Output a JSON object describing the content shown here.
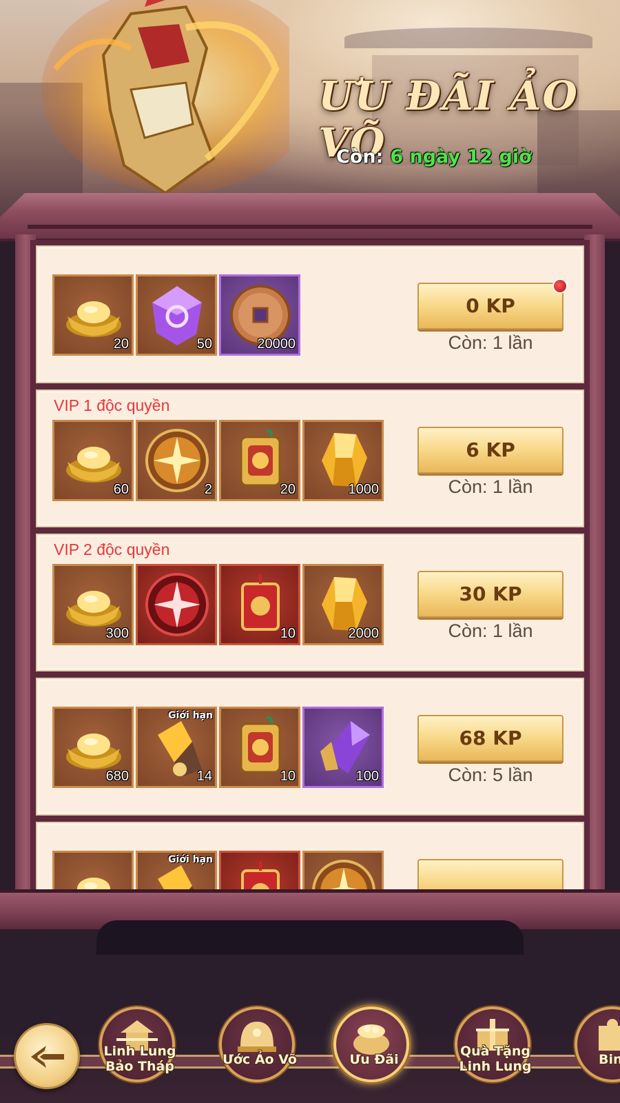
{
  "banner": {
    "title": "ƯU ĐÃI ẢO VÕ",
    "timer_label": "Còn:",
    "timer_value": "6 ngày 12 giờ"
  },
  "offers": [
    {
      "label": "",
      "items": [
        {
          "icon": "gold-ingot-icon",
          "qty": "20",
          "tag": ""
        },
        {
          "icon": "purple-crystal-icon",
          "qty": "50",
          "tag": ""
        },
        {
          "icon": "copper-coin-icon",
          "qty": "20000",
          "tag": ""
        }
      ],
      "price": "0 KP",
      "remaining": "Còn: 1 lần",
      "notification": true
    },
    {
      "label": "VIP 1 độc quyền",
      "items": [
        {
          "icon": "gold-ingot-icon",
          "qty": "60",
          "tag": ""
        },
        {
          "icon": "golden-star-orb-icon",
          "qty": "2",
          "tag": ""
        },
        {
          "icon": "dragon-token-icon",
          "qty": "20",
          "tag": ""
        },
        {
          "icon": "amber-gem-icon",
          "qty": "1000",
          "tag": ""
        }
      ],
      "price": "6 KP",
      "remaining": "Còn: 1 lần",
      "notification": false
    },
    {
      "label": "VIP 2 độc quyền",
      "items": [
        {
          "icon": "gold-ingot-icon",
          "qty": "300",
          "tag": ""
        },
        {
          "icon": "red-star-orb-icon",
          "qty": "",
          "tag": ""
        },
        {
          "icon": "red-talisman-icon",
          "qty": "10",
          "tag": ""
        },
        {
          "icon": "amber-gem-icon",
          "qty": "2000",
          "tag": ""
        }
      ],
      "price": "30 KP",
      "remaining": "Còn: 1 lần",
      "notification": false
    },
    {
      "label": "",
      "items": [
        {
          "icon": "gold-ingot-icon",
          "qty": "680",
          "tag": ""
        },
        {
          "icon": "golden-fragment-icon",
          "qty": "14",
          "tag": "Giới hạn"
        },
        {
          "icon": "dragon-token-icon",
          "qty": "10",
          "tag": ""
        },
        {
          "icon": "violet-shard-icon",
          "qty": "100",
          "tag": ""
        }
      ],
      "price": "68 KP",
      "remaining": "Còn: 5 lần",
      "notification": false
    },
    {
      "label": "",
      "items": [
        {
          "icon": "gold-ingot-icon",
          "qty": "",
          "tag": ""
        },
        {
          "icon": "golden-fragment-icon",
          "qty": "",
          "tag": "Giới hạn"
        },
        {
          "icon": "red-talisman-icon",
          "qty": "",
          "tag": ""
        },
        {
          "icon": "golden-star-orb-icon",
          "qty": "",
          "tag": ""
        }
      ],
      "price": "",
      "remaining": "",
      "notification": false
    }
  ],
  "nav": {
    "back_icon": "back-arrow-icon",
    "items": [
      {
        "label": "Linh Lung\nBảo Tháp",
        "icon": "pagoda-icon",
        "active": false
      },
      {
        "label": "Ước Ảo Võ",
        "icon": "helmet-icon",
        "active": false
      },
      {
        "label": "Ưu Đãi",
        "icon": "treasure-pot-icon",
        "active": true
      },
      {
        "label": "Quà Tặng\nLinh Lung",
        "icon": "gift-tower-icon",
        "active": false
      },
      {
        "label": "Binh",
        "icon": "puzzle-icon",
        "active": false
      }
    ]
  },
  "colors": {
    "accent": "#e8373a",
    "timer_green": "#4ee34a",
    "button_gold": "#f8d888",
    "frame": "#8e4e60"
  }
}
